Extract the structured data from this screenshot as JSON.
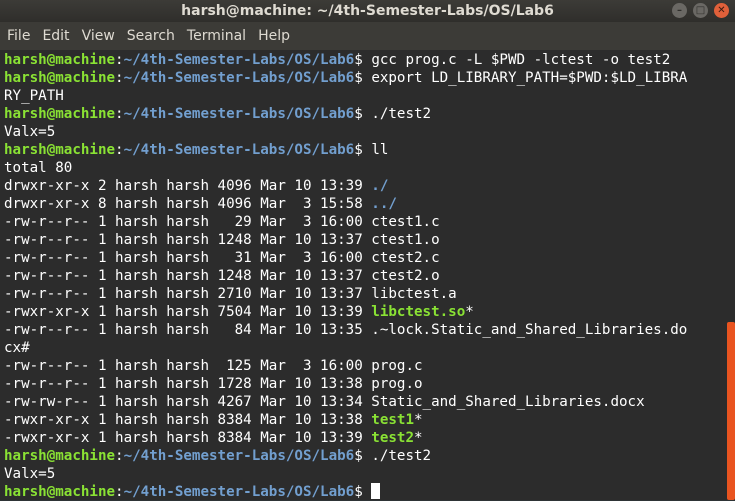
{
  "window": {
    "title": "harsh@machine: ~/4th-Semester-Labs/OS/Lab6"
  },
  "menu": [
    "File",
    "Edit",
    "View",
    "Search",
    "Terminal",
    "Help"
  ],
  "prompt": {
    "user": "harsh@machine",
    "path": "~/4th-Semester-Labs/OS/Lab6"
  },
  "lines": [
    {
      "t": "prompt",
      "cmd": "gcc prog.c -L $PWD -lctest -o test2"
    },
    {
      "t": "prompt",
      "cmd": "export LD_LIBRARY_PATH=$PWD:$LD_LIBRA"
    },
    {
      "t": "text",
      "text": "RY_PATH"
    },
    {
      "t": "prompt",
      "cmd": "./test2"
    },
    {
      "t": "text",
      "text": "Valx=5"
    },
    {
      "t": "prompt",
      "cmd": "ll"
    },
    {
      "t": "text",
      "text": "total 80"
    },
    {
      "t": "ls",
      "meta": "drwxr-xr-x 2 harsh harsh 4096 Mar 10 13:39 ",
      "name": "./",
      "kind": "dir"
    },
    {
      "t": "ls",
      "meta": "drwxr-xr-x 8 harsh harsh 4096 Mar  3 15:58 ",
      "name": "../",
      "kind": "dir"
    },
    {
      "t": "ls",
      "meta": "-rw-r--r-- 1 harsh harsh   29 Mar  3 16:00 ",
      "name": "ctest1.c",
      "kind": "file"
    },
    {
      "t": "ls",
      "meta": "-rw-r--r-- 1 harsh harsh 1248 Mar 10 13:37 ",
      "name": "ctest1.o",
      "kind": "file"
    },
    {
      "t": "ls",
      "meta": "-rw-r--r-- 1 harsh harsh   31 Mar  3 16:00 ",
      "name": "ctest2.c",
      "kind": "file"
    },
    {
      "t": "ls",
      "meta": "-rw-r--r-- 1 harsh harsh 1248 Mar 10 13:37 ",
      "name": "ctest2.o",
      "kind": "file"
    },
    {
      "t": "ls",
      "meta": "-rw-r--r-- 1 harsh harsh 2710 Mar 10 13:37 ",
      "name": "libctest.a",
      "kind": "file"
    },
    {
      "t": "ls",
      "meta": "-rwxr-xr-x 1 harsh harsh 7504 Mar 10 13:39 ",
      "name": "libctest.so",
      "suffix": "*",
      "kind": "exec"
    },
    {
      "t": "ls",
      "meta": "-rw-r--r-- 1 harsh harsh   84 Mar 10 13:35 ",
      "name": ".~lock.Static_and_Shared_Libraries.do",
      "kind": "file"
    },
    {
      "t": "text",
      "text": "cx#"
    },
    {
      "t": "ls",
      "meta": "-rw-r--r-- 1 harsh harsh  125 Mar  3 16:00 ",
      "name": "prog.c",
      "kind": "file"
    },
    {
      "t": "ls",
      "meta": "-rw-r--r-- 1 harsh harsh 1728 Mar 10 13:38 ",
      "name": "prog.o",
      "kind": "file"
    },
    {
      "t": "ls",
      "meta": "-rw-rw-r-- 1 harsh harsh 4267 Mar 10 13:34 ",
      "name": "Static_and_Shared_Libraries.docx",
      "kind": "file"
    },
    {
      "t": "ls",
      "meta": "-rwxr-xr-x 1 harsh harsh 8384 Mar 10 13:38 ",
      "name": "test1",
      "suffix": "*",
      "kind": "exec"
    },
    {
      "t": "ls",
      "meta": "-rwxr-xr-x 1 harsh harsh 8384 Mar 10 13:39 ",
      "name": "test2",
      "suffix": "*",
      "kind": "exec"
    },
    {
      "t": "prompt",
      "cmd": "./test2"
    },
    {
      "t": "text",
      "text": "Valx=5"
    },
    {
      "t": "prompt",
      "cmd": "",
      "cursor": true
    }
  ],
  "colors": {
    "background": "#2c2c2c",
    "user": "#8ae234",
    "path": "#729fcf",
    "accent": "#e95420"
  }
}
